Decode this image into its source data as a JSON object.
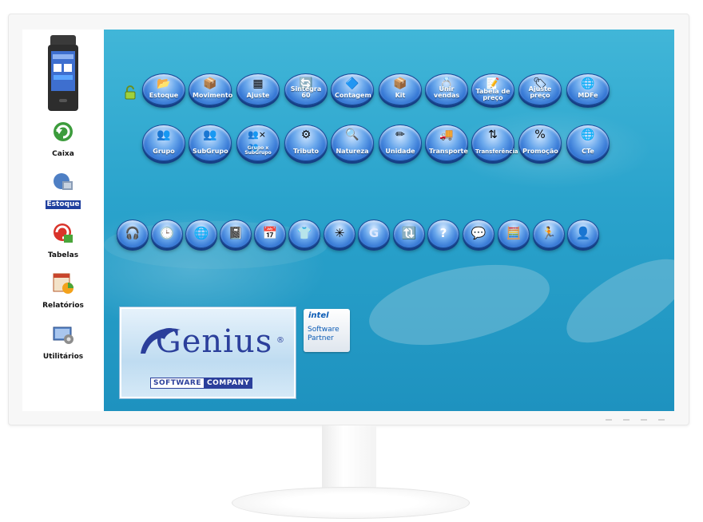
{
  "sidebar": {
    "device_image": "card-terminal",
    "items": [
      {
        "label": "Caixa",
        "icon": "green-arrow-icon",
        "active": false
      },
      {
        "label": "Estoque",
        "icon": "stock-boxes-icon",
        "active": true
      },
      {
        "label": "Tabelas",
        "icon": "tables-icon",
        "active": false
      },
      {
        "label": "Relatórios",
        "icon": "reports-icon",
        "active": false
      },
      {
        "label": "Utilitários",
        "icon": "utilities-icon",
        "active": false
      }
    ]
  },
  "toolbar": {
    "row1": [
      {
        "label": "Estoque",
        "icon": "folder-icon"
      },
      {
        "label": "Movimento",
        "icon": "movement-icon"
      },
      {
        "label": "Ajuste",
        "icon": "adjust-icon"
      },
      {
        "label": "Sintegra 60",
        "icon": "sintegra-icon"
      },
      {
        "label": "Contagem",
        "icon": "counting-icon"
      },
      {
        "label": "Kit",
        "icon": "box-icon"
      },
      {
        "label": "Unir vendas",
        "icon": "rings-icon"
      },
      {
        "label": "Tabela de preço",
        "icon": "price-table-icon"
      },
      {
        "label": "Ajuste preço",
        "icon": "price-adjust-icon"
      },
      {
        "label": "MDFe",
        "icon": "mdfe-icon"
      }
    ],
    "row2": [
      {
        "label": "Grupo",
        "icon": "group-icon"
      },
      {
        "label": "SubGrupo",
        "icon": "subgroup-icon"
      },
      {
        "label": "Grupo x SubGrupo",
        "icon": "group-x-subgroup-icon"
      },
      {
        "label": "Tributo",
        "icon": "tax-icon"
      },
      {
        "label": "Natureza",
        "icon": "nature-icon"
      },
      {
        "label": "Unidade",
        "icon": "unit-icon"
      },
      {
        "label": "Transporte",
        "icon": "truck-icon"
      },
      {
        "label": "Transferência",
        "icon": "transfer-icon"
      },
      {
        "label": "Promoção",
        "icon": "promotion-icon"
      },
      {
        "label": "CTe",
        "icon": "cte-icon"
      }
    ],
    "bottom_row": [
      "headset-icon",
      "clock-icon",
      "globe-icon",
      "note-icon",
      "calendar-icon",
      "shirt-icon",
      "color-fan-icon",
      "genius-g-icon",
      "sync-icon",
      "help-icon",
      "support-icon",
      "calculator-icon",
      "runner-icon",
      "user-icon"
    ]
  },
  "branding": {
    "logo_text": "Genius",
    "registered": "®",
    "software": "SOFTWARE",
    "company": "COMPANY",
    "intel": "intel",
    "partner_line1": "Software",
    "partner_line2": "Partner"
  },
  "colors": {
    "desktop_bg": "#2aa3cc",
    "button_blue": "#2c6fd0",
    "active_label_bg": "#1f3f9e",
    "brand_blue": "#2b3f9b"
  }
}
